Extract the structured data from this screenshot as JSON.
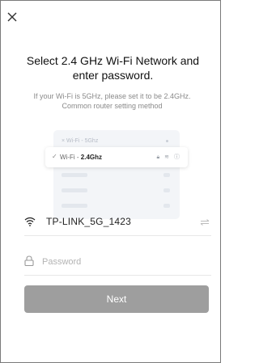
{
  "close_icon": "close-icon",
  "title": "Select 2.4 GHz Wi-Fi Network and enter password.",
  "subtitle": {
    "text": "If your Wi-Fi is 5GHz, please set it to be 2.4GHz.",
    "link": "Common router setting method"
  },
  "illustration": {
    "rows": [
      {
        "prefix": "×",
        "label": "Wi-Fi - 5Ghz"
      },
      {
        "prefix": "✓",
        "label": "Wi-Fi - ",
        "label_bold": "2.4Ghz",
        "icons": "lock wifi info"
      }
    ]
  },
  "wifi": {
    "ssid": "TP-LINK_5G_1423",
    "icon": "wifi-icon",
    "switch_icon": "swap-icon"
  },
  "password": {
    "placeholder": "Password",
    "value": "",
    "icon": "lock-icon"
  },
  "next_label": "Next",
  "colors": {
    "button_disabled": "#9e9e9e",
    "subtitle": "#8a8a8a",
    "illustration_bg": "#f3f5f8"
  }
}
